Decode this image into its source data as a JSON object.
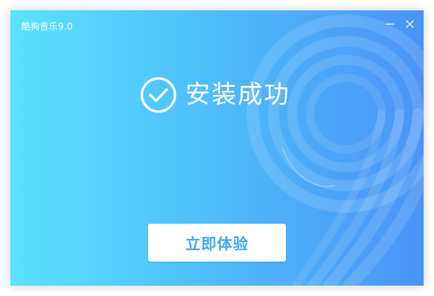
{
  "window": {
    "title": "酷狗音乐9.0",
    "background_colors": [
      "#5ae3fe",
      "#50c0fb",
      "#4a94f6"
    ]
  },
  "controls": {
    "minimize_icon": "minimize-icon",
    "close_icon": "close-icon"
  },
  "status": {
    "icon": "check-circle-icon",
    "message": "安装成功"
  },
  "cta": {
    "label": "立即体验",
    "text_color": "#3fa8f3"
  },
  "decor": {
    "icon": "number-nine-decoration"
  }
}
